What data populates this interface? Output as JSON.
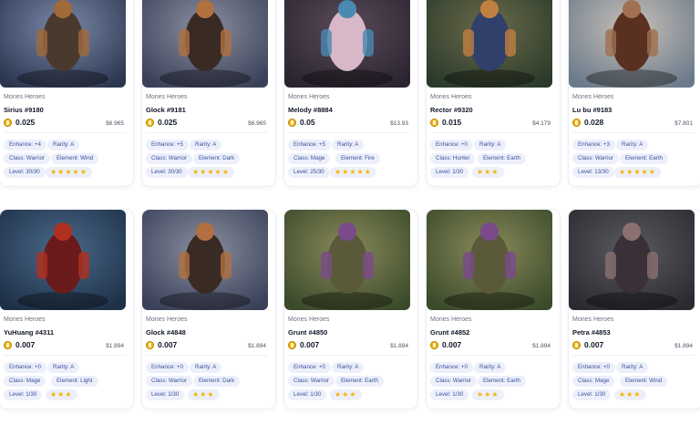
{
  "colors": {
    "coin": "#e8b21a",
    "pill_bg": "#edf0fb",
    "pill_text": "#3a4f9a",
    "star": "#f5b301"
  },
  "cards": [
    {
      "collection": "Mones Heroes",
      "name": "Sirius #9180",
      "price": "0.025",
      "usd": "$6.965",
      "enhance": "Enhance: +4",
      "rarity": "Rarity: A",
      "cls": "Class: Warrior",
      "element": "Element: Wind",
      "level": "Level: 30/30",
      "stars": "★★★★★",
      "art": "warrior-armored"
    },
    {
      "collection": "Mones Heroes",
      "name": "Glock #9181",
      "price": "0.025",
      "usd": "$6.965",
      "enhance": "Enhance: +5",
      "rarity": "Rarity: A",
      "cls": "Class: Warrior",
      "element": "Element: Dark",
      "level": "Level: 30/30",
      "stars": "★★★★★",
      "art": "warrior-dark"
    },
    {
      "collection": "Mones Heroes",
      "name": "Melody #8884",
      "price": "0.05",
      "usd": "$13.93",
      "enhance": "Enhance: +5",
      "rarity": "Rarity: A",
      "cls": "Class: Mage",
      "element": "Element: Fire",
      "level": "Level: 25/30",
      "stars": "★★★★★",
      "art": "mage-girl"
    },
    {
      "collection": "Mones Heroes",
      "name": "Rector #9320",
      "price": "0.015",
      "usd": "$4.179",
      "enhance": "Enhance: +0",
      "rarity": "Rarity: A",
      "cls": "Class: Hunter",
      "element": "Element: Earth",
      "level": "Level: 1/30",
      "stars": "★★★",
      "art": "hunter"
    },
    {
      "collection": "Mones Heroes",
      "name": "Lu bu #9183",
      "price": "0.028",
      "usd": "$7.801",
      "enhance": "Enhance: +3",
      "rarity": "Rarity: A",
      "cls": "Class: Warrior",
      "element": "Element: Earth",
      "level": "Level: 13/30",
      "stars": "★★★★★",
      "art": "spearman"
    },
    {
      "collection": "Mones Heroes",
      "name": "YuHuang #4311",
      "price": "0.007",
      "usd": "$1.894",
      "enhance": "Enhance: +0",
      "rarity": "Rarity: A",
      "cls": "Class: Mage",
      "element": "Element: Light",
      "level": "Level: 1/30",
      "stars": "★★★",
      "art": "red-mage"
    },
    {
      "collection": "Mones Heroes",
      "name": "Glock #4848",
      "price": "0.007",
      "usd": "$1.894",
      "enhance": "Enhance: +0",
      "rarity": "Rarity: A",
      "cls": "Class: Warrior",
      "element": "Element: Dark",
      "level": "Level: 1/30",
      "stars": "★★★",
      "art": "warrior-dark"
    },
    {
      "collection": "Mones Heroes",
      "name": "Grunt #4850",
      "price": "0.007",
      "usd": "$1.894",
      "enhance": "Enhance: +0",
      "rarity": "Rarity: A",
      "cls": "Class: Warrior",
      "element": "Element: Earth",
      "level": "Level: 1/30",
      "stars": "★★★",
      "art": "grunt"
    },
    {
      "collection": "Mones Heroes",
      "name": "Grunt #4852",
      "price": "0.007",
      "usd": "$1.894",
      "enhance": "Enhance: +0",
      "rarity": "Rarity: A",
      "cls": "Class: Warrior",
      "element": "Element: Earth",
      "level": "Level: 1/30",
      "stars": "★★★",
      "art": "grunt"
    },
    {
      "collection": "Mones Heroes",
      "name": "Petra #4853",
      "price": "0.007",
      "usd": "$1.894",
      "enhance": "Enhance: +0",
      "rarity": "Rarity: A",
      "cls": "Class: Mage",
      "element": "Element: Wind",
      "level": "Level: 1/30",
      "stars": "★★★",
      "art": "serpent-mage"
    }
  ]
}
